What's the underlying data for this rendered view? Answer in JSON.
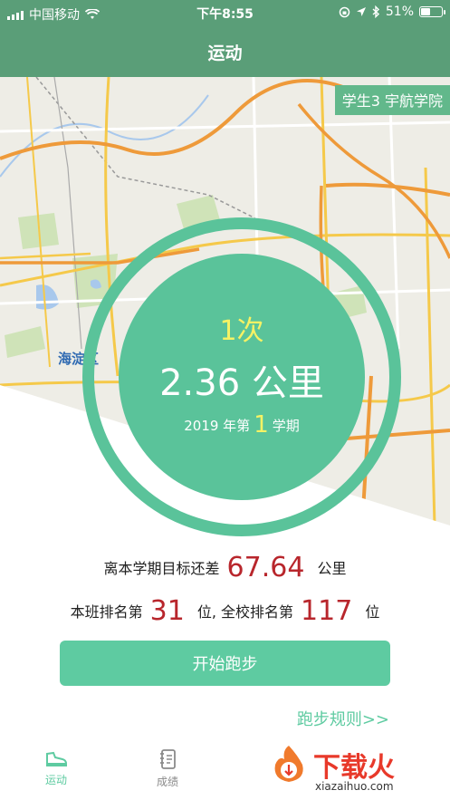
{
  "status_bar": {
    "carrier": "中国移动",
    "time": "下午8:55",
    "battery": "51%",
    "battery_level": 0.51
  },
  "nav": {
    "title": "运动"
  },
  "badge": {
    "text": "学生3 宇航学院"
  },
  "map": {
    "district_label": "海淀区"
  },
  "summary": {
    "count": "1次",
    "distance": "2.36 公里",
    "term_year": "2019 年第",
    "term_number": "1",
    "term_suffix": "学期"
  },
  "stats": {
    "goal_prefix": "离本学期目标还差",
    "goal_value": "67.64",
    "goal_unit": "公里",
    "class_prefix": "本班排名第",
    "class_rank": "31",
    "school_prefix": "位, 全校排名第",
    "school_rank": "117",
    "rank_suffix": "位"
  },
  "actions": {
    "start_button": "开始跑步",
    "rules_link": "跑步规则>>"
  },
  "tabbar": [
    {
      "label": "运动",
      "icon": "shoe-icon",
      "active": true
    },
    {
      "label": "成绩",
      "icon": "notebook-icon",
      "active": false
    }
  ],
  "watermark": {
    "brand": "下载火",
    "url": "xiazaihuo.com"
  },
  "colors": {
    "header": "#5a9e78",
    "accent": "#5ecba1",
    "circle": "#5ac39a",
    "highlight_yellow": "#f7f264",
    "rank_red": "#b8262c"
  }
}
